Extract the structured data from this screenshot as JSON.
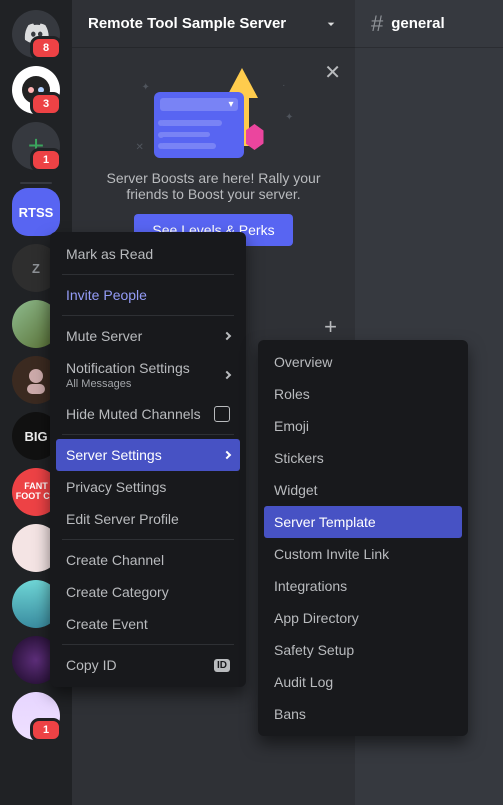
{
  "header": {
    "server_name": "Remote Tool Sample Server",
    "channel_name": "general"
  },
  "boost": {
    "text": "Server Boosts are here! Rally your friends to Boost your server.",
    "button": "See Levels & Perks"
  },
  "rail": {
    "selected_label": "RTSS",
    "items": [
      {
        "type": "discord",
        "badge": "8"
      },
      {
        "type": "avatar",
        "badge": "3"
      },
      {
        "type": "add",
        "badge": "1"
      },
      {
        "type": "selected"
      },
      {
        "type": "letter",
        "letter": "Z"
      },
      {
        "type": "colored"
      },
      {
        "type": "avatar2"
      },
      {
        "type": "dark",
        "letter": "BIG"
      },
      {
        "type": "red",
        "letter": "FANT FOOT CH"
      },
      {
        "type": "pastel"
      },
      {
        "type": "teal"
      },
      {
        "type": "purple"
      },
      {
        "type": "anime",
        "badge": "1"
      }
    ]
  },
  "ctx1": {
    "mark_read": "Mark as Read",
    "invite": "Invite People",
    "mute": "Mute Server",
    "notif": "Notification Settings",
    "notif_sub": "All Messages",
    "hide_muted": "Hide Muted Channels",
    "server_settings": "Server Settings",
    "privacy": "Privacy Settings",
    "edit_profile": "Edit Server Profile",
    "create_channel": "Create Channel",
    "create_category": "Create Category",
    "create_event": "Create Event",
    "copy_id": "Copy ID",
    "id_badge": "ID"
  },
  "ctx2": {
    "items": [
      "Overview",
      "Roles",
      "Emoji",
      "Stickers",
      "Widget",
      "Server Template",
      "Custom Invite Link",
      "Integrations",
      "App Directory",
      "Safety Setup",
      "Audit Log",
      "Bans"
    ],
    "active_index": 5
  }
}
